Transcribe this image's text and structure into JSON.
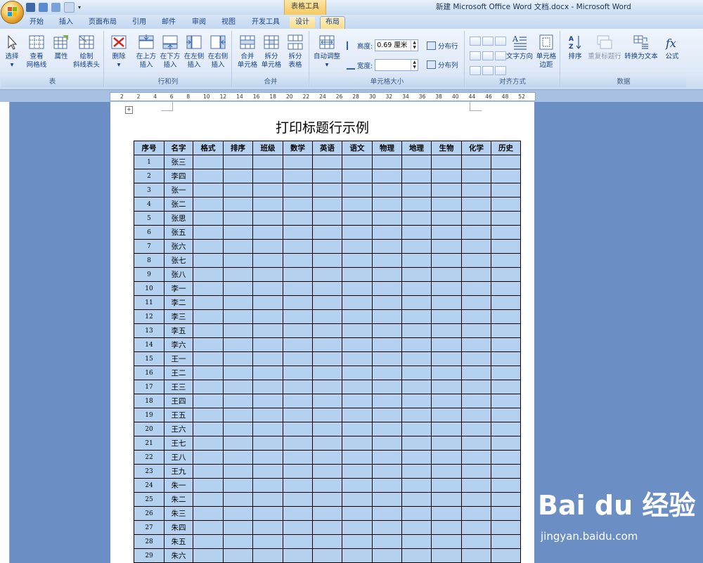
{
  "window": {
    "title": "新建 Microsoft Office Word 文档.docx - Microsoft Word",
    "contextual_group": "表格工具"
  },
  "tabs": [
    {
      "label": "开始"
    },
    {
      "label": "插入"
    },
    {
      "label": "页面布局"
    },
    {
      "label": "引用"
    },
    {
      "label": "邮件"
    },
    {
      "label": "审阅"
    },
    {
      "label": "视图"
    },
    {
      "label": "开发工具"
    },
    {
      "label": "设计"
    },
    {
      "label": "布局",
      "selected": true
    }
  ],
  "ribbon": {
    "table": {
      "label": "表",
      "select": "选择",
      "gridlines": [
        "查看",
        "网格线"
      ],
      "properties": "属性",
      "draw_diag": [
        "绘制",
        "斜线表头"
      ]
    },
    "rows_cols": {
      "label": "行和列",
      "delete": "删除",
      "insert_above": [
        "在上方",
        "插入"
      ],
      "insert_below": [
        "在下方",
        "插入"
      ],
      "insert_left": [
        "在左侧",
        "插入"
      ],
      "insert_right": [
        "在右侧",
        "插入"
      ]
    },
    "merge": {
      "label": "合并",
      "merge_cells": [
        "合并",
        "单元格"
      ],
      "split_cells": [
        "拆分",
        "单元格"
      ],
      "split_table": [
        "拆分",
        "表格"
      ]
    },
    "cell_size": {
      "label": "单元格大小",
      "autofit": "自动调整",
      "height_label": "高度:",
      "height_value": "0.69 厘米",
      "width_label": "宽度:",
      "width_value": "",
      "dist_rows": "分布行",
      "dist_cols": "分布列"
    },
    "alignment": {
      "label": "对齐方式",
      "text_dir": "文字方向",
      "cell_margins": [
        "单元格",
        "边距"
      ]
    },
    "data": {
      "label": "数据",
      "sort": "排序",
      "repeat_header": "重复标题行",
      "to_text": "转换为文本",
      "formula": "公式"
    }
  },
  "ruler_numbers": [
    "2",
    "2",
    "4",
    "6",
    "8",
    "10",
    "12",
    "14",
    "16",
    "18",
    "20",
    "22",
    "24",
    "26",
    "28",
    "30",
    "32",
    "34",
    "36",
    "38",
    "40",
    "44",
    "46",
    "48",
    "52"
  ],
  "document": {
    "title": "打印标题行示例",
    "headers": [
      "序号",
      "名字",
      "格式",
      "排序",
      "班级",
      "数学",
      "英语",
      "语文",
      "物理",
      "地理",
      "生物",
      "化学",
      "历史"
    ],
    "rows": [
      [
        "1",
        "张三"
      ],
      [
        "2",
        "李四"
      ],
      [
        "3",
        "张一"
      ],
      [
        "4",
        "张二"
      ],
      [
        "5",
        "张思"
      ],
      [
        "6",
        "张五"
      ],
      [
        "7",
        "张六"
      ],
      [
        "8",
        "张七"
      ],
      [
        "9",
        "张八"
      ],
      [
        "10",
        "李一"
      ],
      [
        "11",
        "李二"
      ],
      [
        "12",
        "李三"
      ],
      [
        "13",
        "李五"
      ],
      [
        "14",
        "李六"
      ],
      [
        "15",
        "王一"
      ],
      [
        "16",
        "王二"
      ],
      [
        "17",
        "王三"
      ],
      [
        "18",
        "王四"
      ],
      [
        "19",
        "王五"
      ],
      [
        "20",
        "王六"
      ],
      [
        "21",
        "王七"
      ],
      [
        "22",
        "王八"
      ],
      [
        "23",
        "王九"
      ],
      [
        "24",
        "朱一"
      ],
      [
        "25",
        "朱二"
      ],
      [
        "26",
        "朱三"
      ],
      [
        "27",
        "朱四"
      ],
      [
        "28",
        "朱五"
      ],
      [
        "29",
        "朱六"
      ]
    ]
  },
  "watermark": {
    "brand": "Bai du 经验",
    "url": "jingyan.baidu.com"
  }
}
